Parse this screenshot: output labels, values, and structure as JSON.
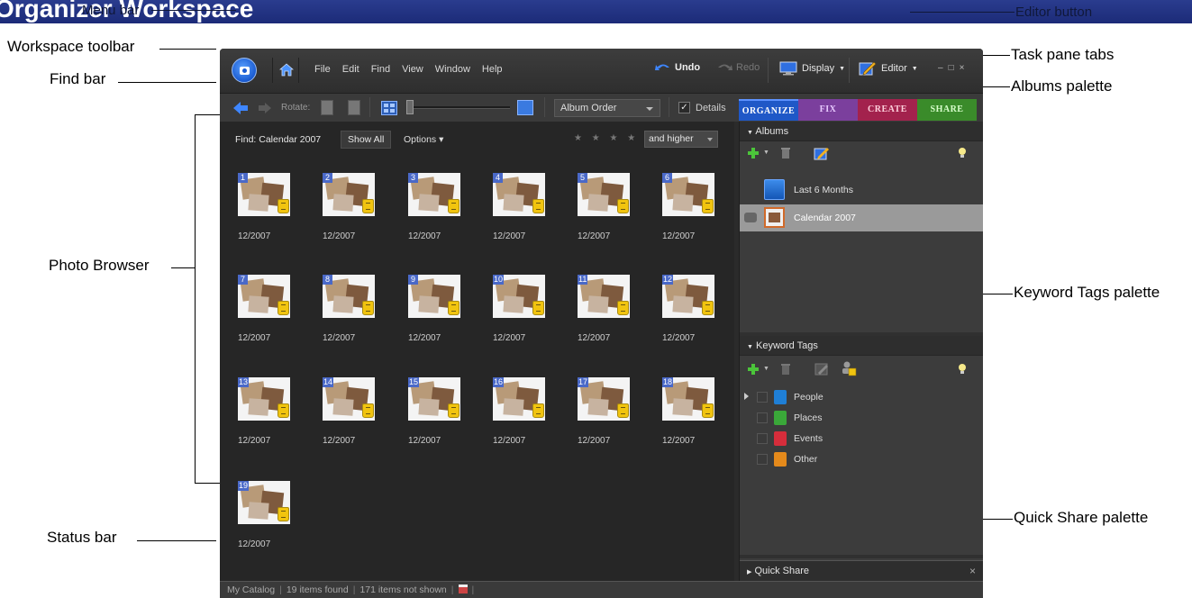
{
  "page": {
    "title": "Organizer Workspace",
    "overlay_labels": [
      "Menu bar",
      "Editor button"
    ]
  },
  "callouts": {
    "workspace_toolbar": "Workspace toolbar",
    "find_bar": "Find bar",
    "photo_browser": "Photo Browser",
    "status_bar": "Status bar",
    "task_pane_tabs": "Task pane tabs",
    "albums_palette": "Albums palette",
    "keyword_tags_palette": "Keyword Tags palette",
    "quick_share_palette": "Quick Share palette"
  },
  "menubar": {
    "items": [
      "File",
      "Edit",
      "Find",
      "View",
      "Window",
      "Help"
    ],
    "undo_label": "Undo",
    "redo_label": "Redo",
    "display_label": "Display",
    "editor_label": "Editor",
    "window_controls": [
      "–",
      "□",
      "×"
    ]
  },
  "findbar": {
    "rotate_label": "Rotate:",
    "order_value": "Album Order",
    "details_label": "Details",
    "details_checked": "✓"
  },
  "tabs": [
    "ORGANIZE",
    "FIX",
    "CREATE",
    "SHARE"
  ],
  "browser": {
    "find_label": "Find: Calendar 2007",
    "show_all_label": "Show All",
    "options_label": "Options ▾",
    "stars": "★ ★ ★ ★ ★",
    "rating_filter": "and higher",
    "thumbnails": [
      {
        "num": "1",
        "date": "12/2007"
      },
      {
        "num": "2",
        "date": "12/2007"
      },
      {
        "num": "3",
        "date": "12/2007"
      },
      {
        "num": "4",
        "date": "12/2007"
      },
      {
        "num": "5",
        "date": "12/2007"
      },
      {
        "num": "6",
        "date": "12/2007"
      },
      {
        "num": "7",
        "date": "12/2007"
      },
      {
        "num": "8",
        "date": "12/2007"
      },
      {
        "num": "9",
        "date": "12/2007"
      },
      {
        "num": "10",
        "date": "12/2007"
      },
      {
        "num": "11",
        "date": "12/2007"
      },
      {
        "num": "12",
        "date": "12/2007"
      },
      {
        "num": "13",
        "date": "12/2007"
      },
      {
        "num": "14",
        "date": "12/2007"
      },
      {
        "num": "15",
        "date": "12/2007"
      },
      {
        "num": "16",
        "date": "12/2007"
      },
      {
        "num": "17",
        "date": "12/2007"
      },
      {
        "num": "18",
        "date": "12/2007"
      },
      {
        "num": "19",
        "date": "12/2007"
      }
    ]
  },
  "status": {
    "catalog": "My Catalog",
    "found": "19 items found",
    "not_shown": "171 items not shown"
  },
  "albums": {
    "header": "Albums",
    "items": [
      "Last 6 Months",
      "Calendar 2007"
    ]
  },
  "keywords": {
    "header": "Keyword Tags",
    "items": [
      {
        "label": "People",
        "color": "#1f7fd6"
      },
      {
        "label": "Places",
        "color": "#3aa839"
      },
      {
        "label": "Events",
        "color": "#d62d3b"
      },
      {
        "label": "Other",
        "color": "#e58a1b"
      }
    ]
  },
  "quick_share": {
    "header": "Quick Share",
    "close": "×"
  }
}
